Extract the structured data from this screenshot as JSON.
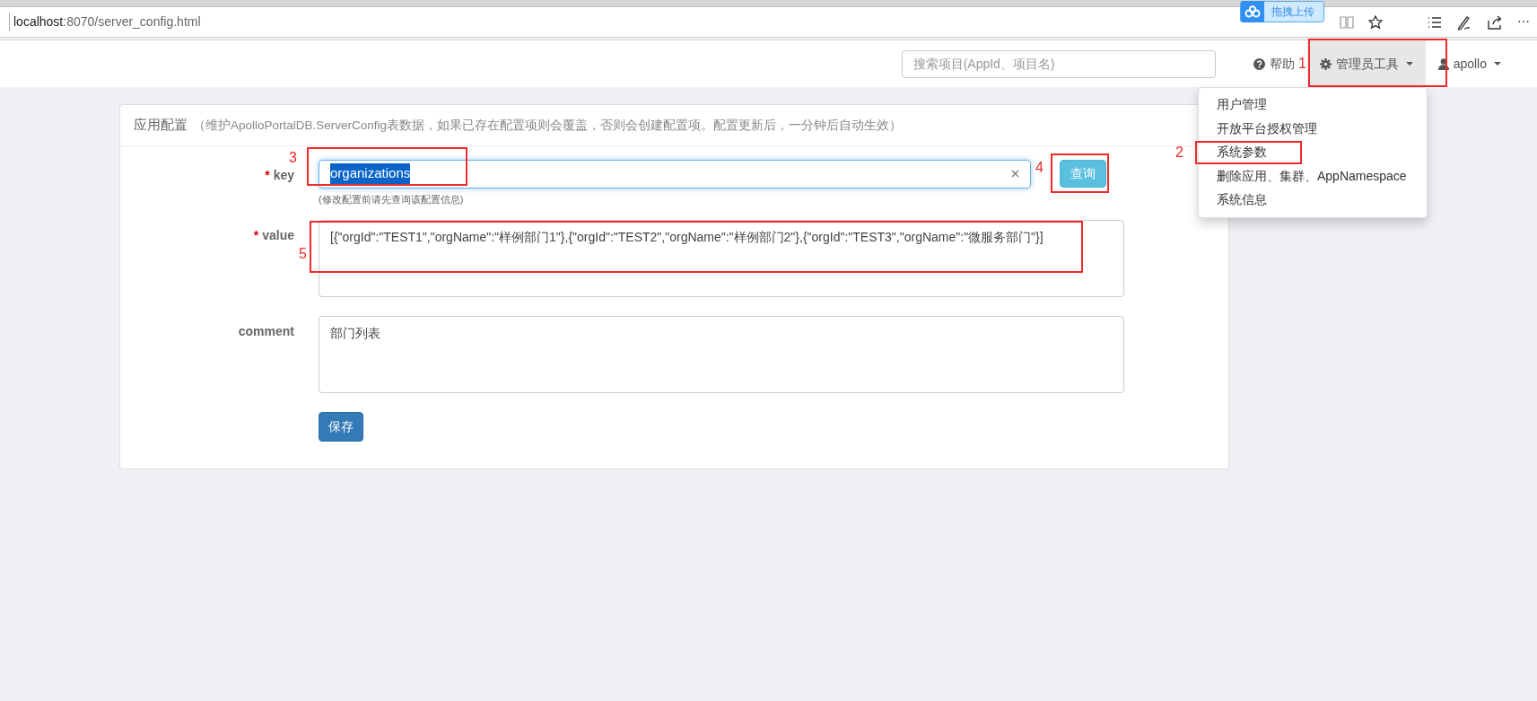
{
  "browser": {
    "url_host": "localhost",
    "url_path": ":8070/server_config.html",
    "upload_button": "拖拽上传",
    "more": "⋯"
  },
  "navbar": {
    "search": {
      "placeholder": "搜索项目(AppId、项目名)"
    },
    "items": [
      {
        "label": "帮助",
        "caret": false,
        "expanded": false
      },
      {
        "label": "管理员工具",
        "caret": true,
        "expanded": true
      },
      {
        "label": "apollo",
        "caret": true,
        "expanded": false
      }
    ]
  },
  "dropdown": {
    "items": [
      "用户管理",
      "开放平台授权管理",
      "系统参数",
      "删除应用、集群、AppNamespace",
      "系统信息"
    ]
  },
  "card": {
    "title": "应用配置",
    "note": "（维护ApolloPortalDB.ServerConfig表数据，如果已存在配置项则会覆盖，否则会创建配置项。配置更新后，一分钟后自动生效）"
  },
  "form": {
    "fields": [
      {
        "kind": "input",
        "required_mark": "*",
        "label": "key",
        "value": "organizations",
        "highlighted": true,
        "hint": "(修改配置前请先查询该配置信息)",
        "button": "查询"
      },
      {
        "kind": "textarea",
        "required_mark": "*",
        "label": "value",
        "value": "[{\"orgId\":\"TEST1\",\"orgName\":\"样例部门1\"},{\"orgId\":\"TEST2\",\"orgName\":\"样例部门2\"},{\"orgId\":\"TEST3\",\"orgName\":\"微服务部门\"}]"
      },
      {
        "kind": "textarea",
        "label": "comment",
        "value": "部门列表"
      }
    ],
    "save_button": "保存"
  },
  "annotations": [
    {
      "number": "1"
    },
    {
      "number": "2"
    },
    {
      "number": "3"
    },
    {
      "number": "4"
    },
    {
      "number": "5"
    }
  ]
}
